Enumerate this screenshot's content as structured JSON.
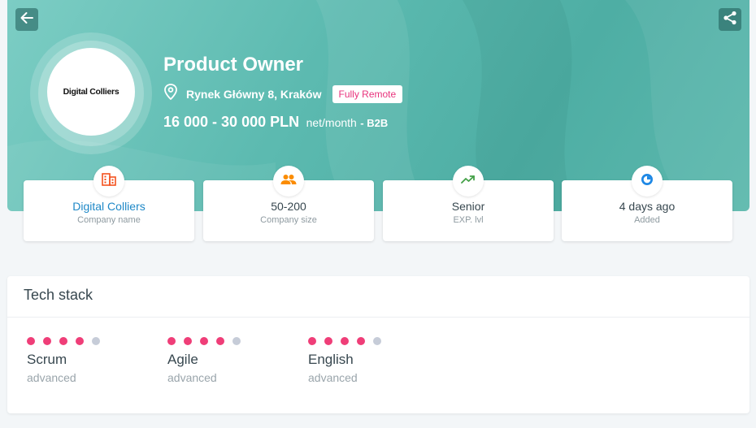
{
  "header": {
    "title": "Product Owner",
    "location": "Rynek Główny 8, Kraków",
    "remote_badge": "Fully Remote",
    "salary": "16 000 - 30 000 PLN",
    "salary_unit": "net/month",
    "contract": "- B2B",
    "company_logo_text": "Digital Colliers",
    "back_icon": "arrow-left-icon",
    "share_icon": "share-icon"
  },
  "info_cards": [
    {
      "value": "Digital Colliers",
      "label": "Company name",
      "icon": "building-icon",
      "color": "#f4511e"
    },
    {
      "value": "50-200",
      "label": "Company size",
      "icon": "people-icon",
      "color": "#fb8c00"
    },
    {
      "value": "Senior",
      "label": "EXP. lvl",
      "icon": "trending-up-icon",
      "color": "#43a047"
    },
    {
      "value": "4 days ago",
      "label": "Added",
      "icon": "clock-icon",
      "color": "#1e88e5"
    }
  ],
  "tech_stack": {
    "title": "Tech stack",
    "skills": [
      {
        "name": "Scrum",
        "level": "advanced",
        "rating": 4,
        "max": 5
      },
      {
        "name": "Agile",
        "level": "advanced",
        "rating": 4,
        "max": 5
      },
      {
        "name": "English",
        "level": "advanced",
        "rating": 4,
        "max": 5
      }
    ]
  },
  "colors": {
    "accent_pink": "#ef3e78",
    "hero_teal": "#5cbab0",
    "link_blue": "#1e88c7"
  }
}
